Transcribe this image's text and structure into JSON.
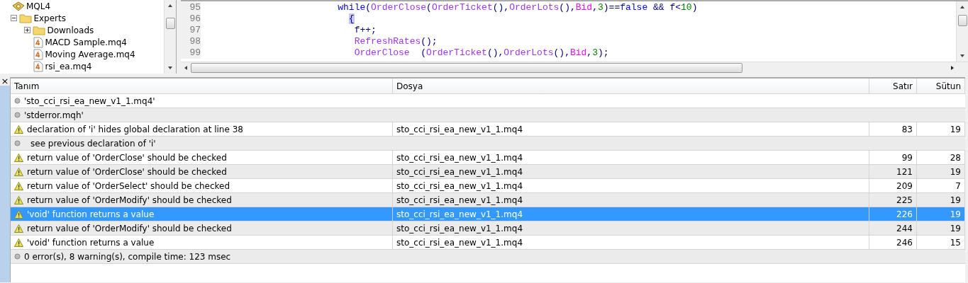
{
  "navigator": {
    "tree": [
      {
        "label": "MQL4",
        "kind": "root",
        "children": [
          {
            "label": "Experts",
            "kind": "folder",
            "expanded": true,
            "children": [
              {
                "label": "Downloads",
                "kind": "folder",
                "expanded": false
              },
              {
                "label": "MACD Sample.mq4",
                "kind": "file"
              },
              {
                "label": "Moving Average.mq4",
                "kind": "file"
              },
              {
                "label": "rsi_ea.mq4",
                "kind": "file"
              }
            ]
          }
        ]
      }
    ]
  },
  "editor": {
    "lines": [
      {
        "number": "95",
        "tokens": [
          {
            "kind": "keyword",
            "text": "                        while"
          },
          {
            "kind": "plain",
            "text": "("
          },
          {
            "kind": "function",
            "text": "OrderClose"
          },
          {
            "kind": "plain",
            "text": "("
          },
          {
            "kind": "function",
            "text": "OrderTicket"
          },
          {
            "kind": "plain",
            "text": "(),"
          },
          {
            "kind": "function",
            "text": "OrderLots"
          },
          {
            "kind": "plain",
            "text": "(),"
          },
          {
            "kind": "variable",
            "text": "Bid"
          },
          {
            "kind": "plain",
            "text": ","
          },
          {
            "kind": "number",
            "text": "3"
          },
          {
            "kind": "plain",
            "text": ")=="
          },
          {
            "kind": "keyword",
            "text": "false"
          },
          {
            "kind": "plain",
            "text": " && f<"
          },
          {
            "kind": "number",
            "text": "10"
          },
          {
            "kind": "plain",
            "text": ")"
          }
        ]
      },
      {
        "number": "96",
        "tokens": [
          {
            "kind": "bracket",
            "text": "                          {",
            "highlighted": true
          }
        ]
      },
      {
        "number": "97",
        "tokens": [
          {
            "kind": "plain",
            "text": "                           f++;"
          }
        ]
      },
      {
        "number": "98",
        "tokens": [
          {
            "kind": "function",
            "text": "                           RefreshRates"
          },
          {
            "kind": "plain",
            "text": "();"
          }
        ]
      },
      {
        "number": "99",
        "tokens": [
          {
            "kind": "function",
            "text": "                           OrderClose"
          },
          {
            "kind": "plain",
            "text": "  ("
          },
          {
            "kind": "function",
            "text": "OrderTicket"
          },
          {
            "kind": "plain",
            "text": "(),"
          },
          {
            "kind": "function",
            "text": "OrderLots"
          },
          {
            "kind": "plain",
            "text": "(),"
          },
          {
            "kind": "variable",
            "text": "Bid"
          },
          {
            "kind": "plain",
            "text": ","
          },
          {
            "kind": "number",
            "text": "3"
          },
          {
            "kind": "plain",
            "text": ");"
          }
        ]
      }
    ]
  },
  "toolbox": {
    "close_glyph": "×",
    "table": {
      "columns": [
        "Tanım",
        "Dosya",
        "Satır",
        "Sütun"
      ],
      "rows": [
        {
          "kind": "info",
          "description": "'sto_cci_rsi_ea_new_v1_1.mq4'",
          "selected": false
        },
        {
          "kind": "info",
          "description": "'stderror.mqh'",
          "selected": false
        },
        {
          "kind": "warning",
          "description": "declaration of 'i' hides global declaration at line 38",
          "file": "sto_cci_rsi_ea_new_v1_1.mq4",
          "line": "83",
          "column": "19",
          "selected": false
        },
        {
          "kind": "note",
          "description": "see previous declaration of 'i'",
          "selected": false
        },
        {
          "kind": "warning",
          "description": "return value of 'OrderClose' should be checked",
          "file": "sto_cci_rsi_ea_new_v1_1.mq4",
          "line": "99",
          "column": "28",
          "selected": false
        },
        {
          "kind": "warning",
          "description": "return value of 'OrderClose' should be checked",
          "file": "sto_cci_rsi_ea_new_v1_1.mq4",
          "line": "121",
          "column": "19",
          "selected": false
        },
        {
          "kind": "warning",
          "description": "return value of 'OrderSelect' should be checked",
          "file": "sto_cci_rsi_ea_new_v1_1.mq4",
          "line": "209",
          "column": "7",
          "selected": false
        },
        {
          "kind": "warning",
          "description": "return value of 'OrderModify' should be checked",
          "file": "sto_cci_rsi_ea_new_v1_1.mq4",
          "line": "225",
          "column": "19",
          "selected": false
        },
        {
          "kind": "warning",
          "description": "'void' function returns a value",
          "file": "sto_cci_rsi_ea_new_v1_1.mq4",
          "line": "226",
          "column": "19",
          "selected": true
        },
        {
          "kind": "warning",
          "description": "return value of 'OrderModify' should be checked",
          "file": "sto_cci_rsi_ea_new_v1_1.mq4",
          "line": "244",
          "column": "19",
          "selected": false
        },
        {
          "kind": "warning",
          "description": "'void' function returns a value",
          "file": "sto_cci_rsi_ea_new_v1_1.mq4",
          "line": "246",
          "column": "15",
          "selected": false
        },
        {
          "kind": "info",
          "description": "0 error(s), 8 warning(s), compile time: 123 msec",
          "selected": false
        }
      ]
    }
  }
}
